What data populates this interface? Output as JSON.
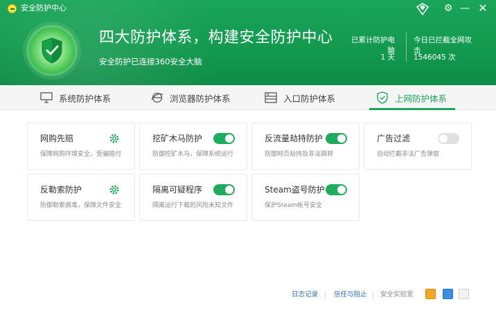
{
  "window": {
    "title": "安全防护中心",
    "controls": {
      "badge_icon": "badge-icon",
      "gear_icon": "gear-icon",
      "minimize": "—",
      "close": "✕"
    }
  },
  "header": {
    "headline": "四大防护体系，构建安全防护中心",
    "subline": "安全防护已连接360安全大脑",
    "stats": [
      {
        "label": "已累计防护电脑",
        "value": "1 天"
      },
      {
        "label": "今日已拦截全网攻击",
        "value": "1546045 次"
      }
    ]
  },
  "tabs": [
    {
      "label": "系统防护体系",
      "icon": "monitor-icon",
      "active": false
    },
    {
      "label": "浏览器防护体系",
      "icon": "browser-icon",
      "active": false
    },
    {
      "label": "入口防护体系",
      "icon": "entrance-icon",
      "active": false
    },
    {
      "label": "上网防护体系",
      "icon": "shield-check-icon",
      "active": true
    }
  ],
  "cards": [
    {
      "title": "网购先赔",
      "desc": "保障网购环境安全，受骗赔付",
      "control": "gear"
    },
    {
      "title": "挖矿木马防护",
      "desc": "防御挖矿木马，保障系统运行",
      "control": "on"
    },
    {
      "title": "反流量劫持防护",
      "desc": "防御网页劫持及非法跳转",
      "control": "on"
    },
    {
      "title": "广告过滤",
      "desc": "自动拦截非法广告弹窗",
      "control": "off"
    },
    {
      "title": "反勒索防护",
      "desc": "防御勒索病毒，保障文件安全",
      "control": "gear"
    },
    {
      "title": "隔离可疑程序",
      "desc": "隔离运行下载的风险未知文件",
      "control": "on"
    },
    {
      "title": "Steam盗号防护",
      "desc": "保护Steam帐号安全",
      "control": "on"
    }
  ],
  "footer": {
    "links": [
      "日志记录",
      "信任与阻止",
      "安全实验室"
    ],
    "colors": {
      "accent": "#1aa55a",
      "link": "#2b6fb8"
    }
  }
}
